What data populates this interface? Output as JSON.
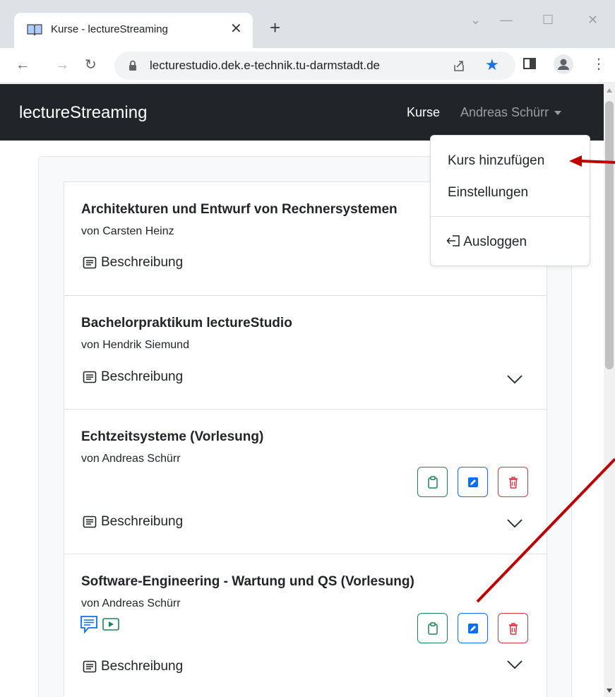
{
  "browser": {
    "tab_title": "Kurse - lectureStreaming",
    "url": "lecturestudio.dek.e-technik.tu-darmstadt.de"
  },
  "navbar": {
    "brand": "lectureStreaming",
    "kurse": "Kurse",
    "user": "Andreas Schürr"
  },
  "dropdown": {
    "items": [
      "Kurs hinzufügen",
      "Einstellungen",
      "Ausloggen"
    ]
  },
  "courses": [
    {
      "title": "Architekturen und Entwurf von Rechnersystemen",
      "author": "von Carsten Heinz",
      "description": "Beschreibung"
    },
    {
      "title": "Bachelorpraktikum lectureStudio",
      "author": "von Hendrik Siemund",
      "description": "Beschreibung"
    },
    {
      "title": "Echtzeitsysteme (Vorlesung)",
      "author": "von Andreas Schürr",
      "description": "Beschreibung"
    },
    {
      "title": "Software-Engineering - Wartung und QS (Vorlesung)",
      "author": "von Andreas Schürr",
      "description": "Beschreibung"
    }
  ],
  "colors": {
    "navbar_bg": "#212529",
    "copy_green": "#198754",
    "edit_blue": "#0d6efd",
    "delete_red": "#dc3545",
    "annotation_arrow": "#c00000"
  }
}
